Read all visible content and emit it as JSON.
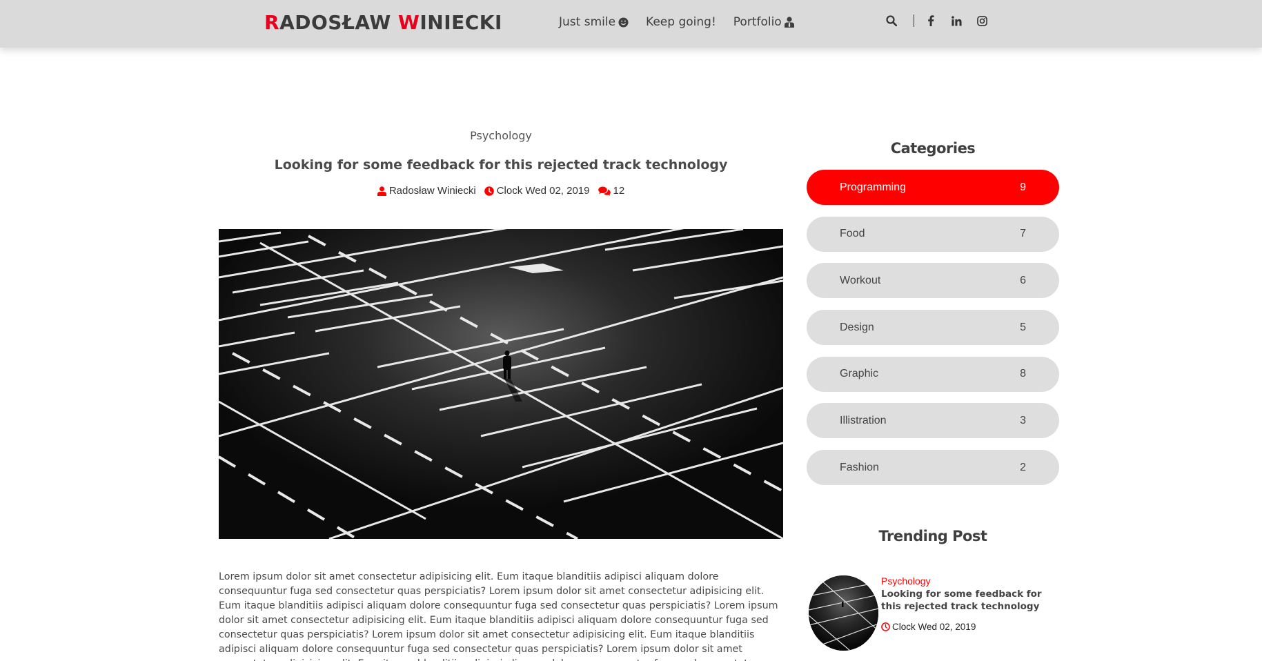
{
  "header": {
    "logo": {
      "first_initial": "R",
      "first_rest": "ADOSŁAW ",
      "last_initial": "W",
      "last_rest": "INIECKI"
    },
    "nav": [
      {
        "label": "Just smile",
        "icon": "smile-icon"
      },
      {
        "label": "Keep going!",
        "icon": ""
      },
      {
        "label": "Portfolio",
        "icon": "user-tie-icon"
      }
    ],
    "tools": [
      "search-icon",
      "facebook-icon",
      "linkedin-icon",
      "instagram-icon"
    ]
  },
  "article": {
    "category": "Psychology",
    "title": "Looking for some feedback for this rejected track technology",
    "author": "Radosław Winiecki",
    "date": "Clock Wed 02, 2019",
    "comments": "12",
    "body": "Lorem ipsum dolor sit amet consectetur adipisicing elit. Eum itaque blanditiis adipisci aliquam dolore consequuntur fuga sed consectetur quas perspiciatis? Lorem ipsum dolor sit amet consectetur adipisicing elit. Eum itaque blanditiis adipisci aliquam dolore consequuntur fuga sed consectetur quas perspiciatis? Lorem ipsum dolor sit amet consectetur adipisicing elit. Eum itaque blanditiis adipisci aliquam dolore consequuntur fuga sed consectetur quas perspiciatis? Lorem ipsum dolor sit amet consectetur adipisicing elit. Eum itaque blanditiis adipisci aliquam dolore consequuntur fuga sed consectetur quas perspiciatis? Lorem ipsum dolor sit amet consectetur adipisicing elit. Eum itaque blanditiis adipisci aliquam dolore consequuntur fuga sed consectetur quas perspiciatis?"
  },
  "sidebar": {
    "categories_heading": "Categories",
    "categories": [
      {
        "name": "Programming",
        "count": "9",
        "active": true
      },
      {
        "name": "Food",
        "count": "7",
        "active": false
      },
      {
        "name": "Workout",
        "count": "6",
        "active": false
      },
      {
        "name": "Design",
        "count": "5",
        "active": false
      },
      {
        "name": "Graphic",
        "count": "8",
        "active": false
      },
      {
        "name": "Illistration",
        "count": "3",
        "active": false
      },
      {
        "name": "Fashion",
        "count": "2",
        "active": false
      }
    ],
    "trending_heading": "Trending Post",
    "trending": {
      "category": "Psychology",
      "title": "Looking for some feedback for this rejected track technology",
      "date": "Clock Wed 02, 2019"
    }
  },
  "colors": {
    "accent": "#ff0000",
    "header_bg": "#dadada",
    "pill_bg": "#dedede"
  }
}
